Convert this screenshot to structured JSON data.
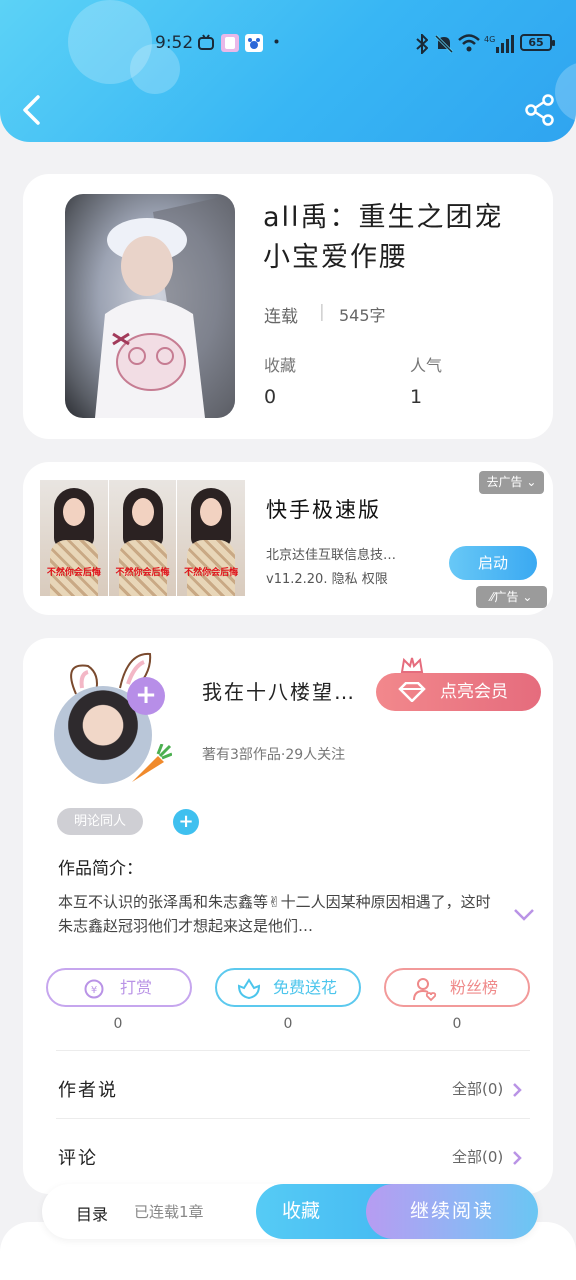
{
  "status_bar": {
    "time": "9:52",
    "battery": "65",
    "icons": [
      "bilibili-icon",
      "app-icon",
      "paw-icon",
      "bluetooth-icon",
      "mute-icon",
      "wifi-icon",
      "signal-icon"
    ]
  },
  "header": {
    "back_icon": "back-arrow-icon",
    "share_icon": "share-icon"
  },
  "book": {
    "title": "all禹：重生之团宠小宝爱作腰",
    "status": "连载",
    "word_count": "545字",
    "favorites_label": "收藏",
    "favorites_value": "0",
    "popularity_label": "人气",
    "popularity_value": "1"
  },
  "ad": {
    "image_caption": "不然你会后悔",
    "title": "快手极速版",
    "publisher": "北京达佳互联信息技…",
    "version_line": "v11.2.20. 隐私 权限",
    "button": "启动",
    "remove_ad": "去广告",
    "ad_label": "广告"
  },
  "author": {
    "name": "我在十八楼望…",
    "vip_button": "点亮会员",
    "meta": "著有3部作品·29人关注",
    "tag": "明论同人",
    "intro_heading": "作品简介：",
    "intro_text": "本互不认识的张泽禹和朱志鑫等✌十二人因某种原因相遇了，这时朱志鑫赵冠羽他们才想起来这是他们…"
  },
  "actions": [
    {
      "label": "打赏",
      "count": "0",
      "color": "#b993e6"
    },
    {
      "label": "免费送花",
      "count": "0",
      "color": "#4cc5ec"
    },
    {
      "label": "粉丝榜",
      "count": "0",
      "color": "#ef8a8a"
    }
  ],
  "rows": [
    {
      "label": "作者说",
      "right": "全部(0)"
    },
    {
      "label": "评论",
      "right": "全部(0)"
    }
  ],
  "bottom": {
    "toc": "目录",
    "serial": "已连载1章",
    "favorite": "收藏",
    "continue": "继续阅读"
  },
  "colors": {
    "header": "#38b6f4",
    "accent_purple": "#b79cf2",
    "vip": "#e56c7d"
  }
}
